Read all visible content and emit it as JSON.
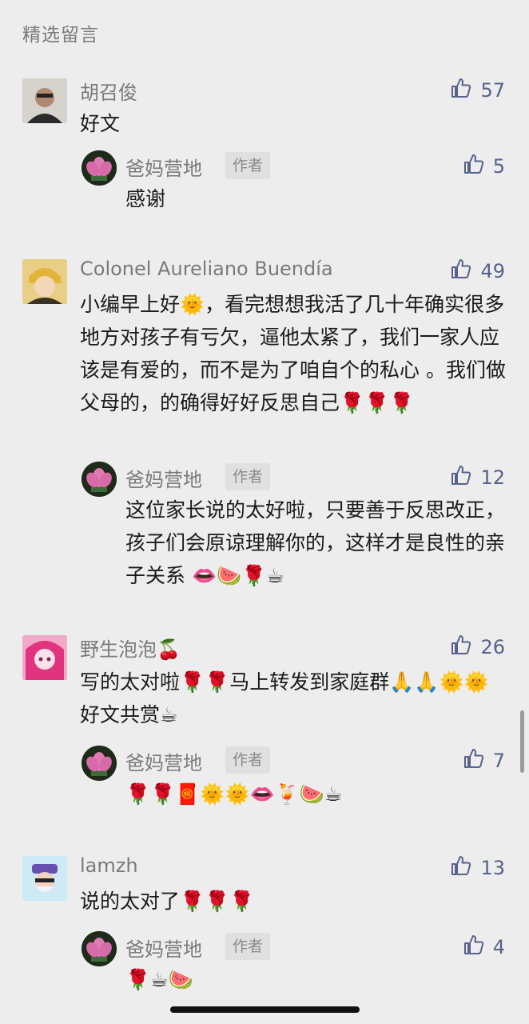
{
  "section_title": "精选留言",
  "colors": {
    "like_blue": "#56618c",
    "name_gray": "#7a7a7a",
    "background": "#ededed"
  },
  "comments": [
    {
      "name": "胡召俊",
      "likes": "57",
      "text": "好文",
      "reply": {
        "name": "爸妈营地",
        "tag": "作者",
        "likes": "5",
        "text": "感谢"
      }
    },
    {
      "name": "Colonel Aureliano Buendía",
      "likes": "49",
      "text": "小编早上好🌞，看完想想我活了几十年确实很多地方对孩子有亏欠，逼他太紧了，我们一家人应该是有爱的，而不是为了咱自个的私心 。我们做父母的，的确得好好反思自己🌹🌹🌹",
      "reply": {
        "name": "爸妈营地",
        "tag": "作者",
        "likes": "12",
        "text": "这位家长说的太好啦，只要善于反思改正，孩子们会原谅理解你的，这样才是良性的亲子关系 👄🍉🌹☕"
      }
    },
    {
      "name": "野生泡泡🍒",
      "likes": "26",
      "text": "写的太对啦🌹🌹马上转发到家庭群🙏🙏🌞🌞好文共赏☕",
      "reply": {
        "name": "爸妈营地",
        "tag": "作者",
        "likes": "7",
        "text": "🌹🌹🧧🌞🌞👄🍹🍉☕"
      }
    },
    {
      "name": "lamzh",
      "likes": "13",
      "text": "说的太对了🌹🌹🌹",
      "reply": {
        "name": "爸妈营地",
        "tag": "作者",
        "likes": "4",
        "text": "🌹☕🍉"
      }
    }
  ]
}
